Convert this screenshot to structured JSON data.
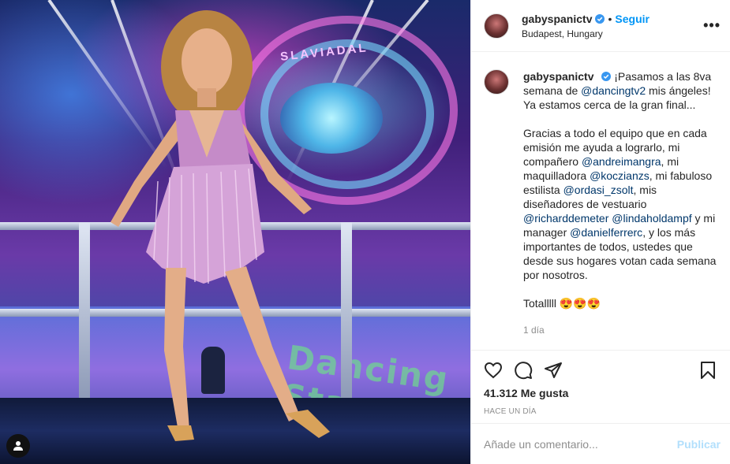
{
  "post": {
    "username": "gabyspanictv",
    "verified_icon": "verified-badge-icon",
    "separator": "•",
    "follow_label": "Seguir",
    "location": "Budapest, Hungary",
    "more_icon": "more-options-icon",
    "more_glyph": "•••"
  },
  "photo": {
    "floor_text": "Dancing Stars",
    "stage_text": "SLAVIADAL"
  },
  "caption": {
    "username": "gabyspanictv",
    "line1_pre": "¡Pasamos a las 8va semana de ",
    "mention_dancingtv2": "@dancingtv2",
    "line1_post": " mis ángeles! Ya estamos cerca de la gran final...",
    "p2_a": "Gracias a todo el equipo que en cada emisión me ayuda a lograrlo, mi compañero ",
    "mention_andreimangra": "@andreimangra",
    "p2_b": ", mi maquilladora ",
    "mention_koczianzs": "@koczianzs",
    "p2_c": ", mi fabuloso estilista ",
    "mention_ordasi": "@ordasi_zsolt",
    "p2_d": ", mis diseñadores de vestuario ",
    "mention_richard": "@richarddemeter",
    "p2_e": " ",
    "mention_linda": "@lindaholdampf",
    "p2_f": " y mi manager ",
    "mention_daniel": "@danielferrerc",
    "p2_g": ", y los más importantes de todos, ustedes que desde sus hogares votan cada semana por nosotros.",
    "p3": "Totalllll 😍😍😍",
    "time": "1 día"
  },
  "actions": {
    "like_icon": "heart-icon",
    "comment_icon": "comment-icon",
    "share_icon": "share-icon",
    "save_icon": "bookmark-icon",
    "likes": "41.312 Me gusta",
    "date": "HACE UN DÍA"
  },
  "comment_box": {
    "placeholder": "Añade un comentario...",
    "publish_label": "Publicar"
  },
  "colors": {
    "accent": "#0095f6",
    "mention": "#00376b",
    "muted": "#8e8e8e",
    "publish_disabled": "#b2dffc"
  }
}
